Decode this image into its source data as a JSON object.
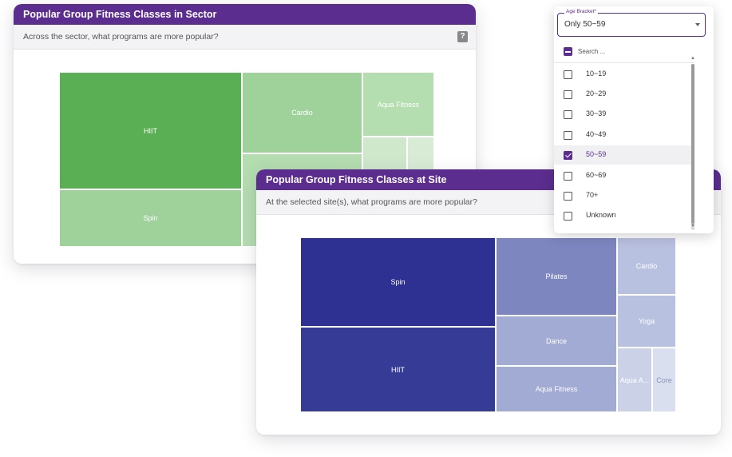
{
  "sector_card": {
    "title": "Popular Group Fitness Classes in Sector",
    "subtitle": "Across the sector, what programs are more popular?",
    "help_icon": "question-mark-icon",
    "accent_color": "#5b2d8e",
    "tiles": [
      {
        "label": "HIIT",
        "color": "#5aae54"
      },
      {
        "label": "Spin",
        "color": "#9fd29a"
      },
      {
        "label": "Cardio",
        "color": "#9fd29a"
      },
      {
        "label": "Aqua Fitness",
        "color": "#b4ddb0"
      },
      {
        "label": "",
        "color": "#cfe8cc"
      }
    ]
  },
  "site_card": {
    "title": "Popular Group Fitness Classes at Site",
    "subtitle": "At the selected site(s), what programs are more popular?",
    "tiles": [
      {
        "label": "Spin",
        "color": "#2e3192"
      },
      {
        "label": "HIIT",
        "color": "#363c96"
      },
      {
        "label": "Pilates",
        "color": "#7d86bf"
      },
      {
        "label": "Dance",
        "color": "#a2abd4"
      },
      {
        "label": "Aqua Fitness",
        "color": "#a2abd4"
      },
      {
        "label": "Cardio",
        "color": "#b9c1e0"
      },
      {
        "label": "Yoga",
        "color": "#b9c1e0"
      },
      {
        "label": "Aqua A...",
        "color": "#cbd2e8"
      },
      {
        "label": "Core",
        "color": "#d9dfee"
      }
    ]
  },
  "age_filter": {
    "label": "Age Bracket*",
    "value": "Only 50~59",
    "search_placeholder": "Search ...",
    "options": [
      {
        "label": "10~19",
        "checked": false
      },
      {
        "label": "20~29",
        "checked": false
      },
      {
        "label": "30~39",
        "checked": false
      },
      {
        "label": "40~49",
        "checked": false
      },
      {
        "label": "50~59",
        "checked": true
      },
      {
        "label": "60~69",
        "checked": false
      },
      {
        "label": "70+",
        "checked": false
      },
      {
        "label": "Unknown",
        "checked": false
      }
    ]
  }
}
